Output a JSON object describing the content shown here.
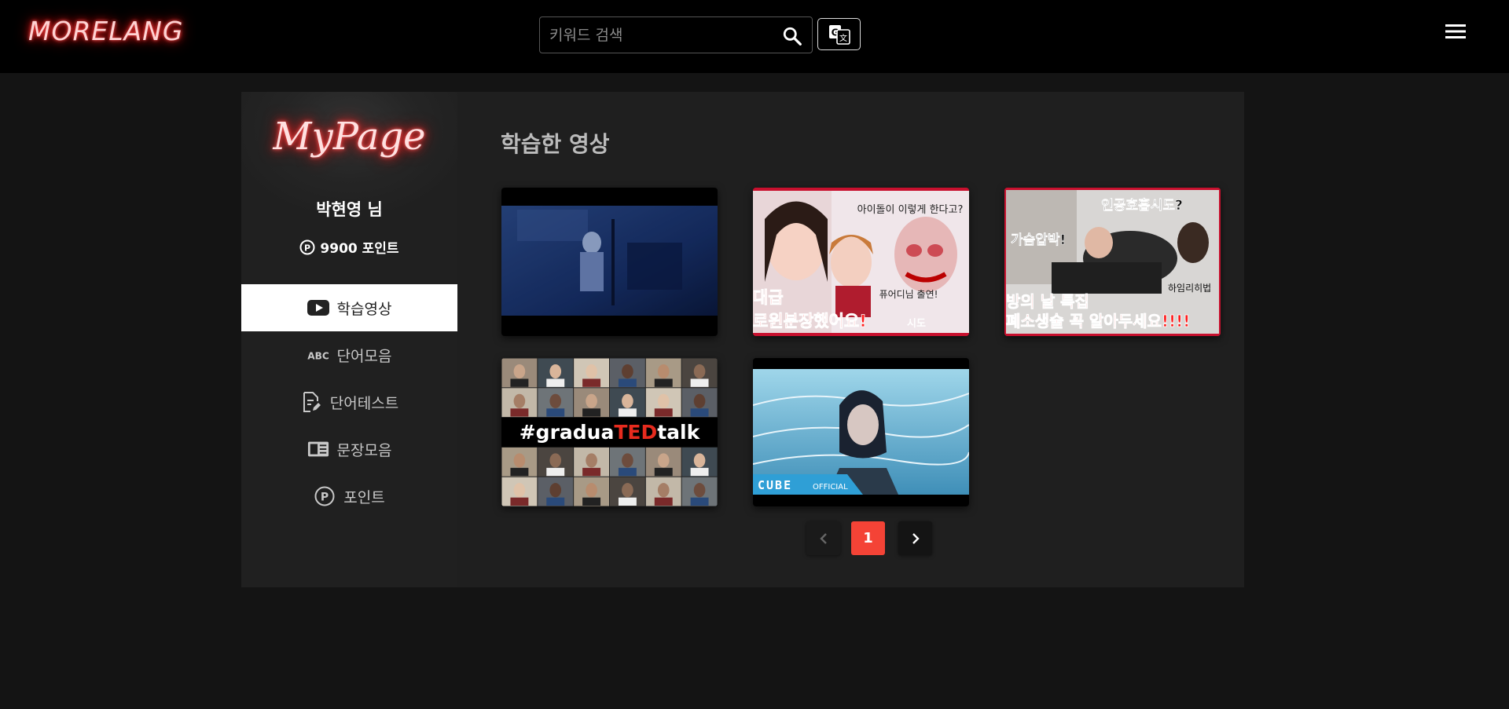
{
  "header": {
    "logo": "MORELANG",
    "search": {
      "placeholder": "키워드 검색",
      "value": ""
    },
    "icons": {
      "search": "search-icon",
      "translate": "translate-icon",
      "menu": "hamburger-menu-icon"
    }
  },
  "sidebar": {
    "logo": "MyPage",
    "user_name": "박현영 님",
    "points_text": "9900 포인트",
    "items": [
      {
        "label": "학습영상",
        "icon": "youtube-icon",
        "active": true
      },
      {
        "label": "단어모음",
        "icon": "abc-icon",
        "active": false
      },
      {
        "label": "단어테스트",
        "icon": "document-edit-icon",
        "active": false
      },
      {
        "label": "문장모음",
        "icon": "article-icon",
        "active": false
      },
      {
        "label": "포인트",
        "icon": "points-icon",
        "active": false
      }
    ]
  },
  "main": {
    "title": "학습한 영상",
    "videos": [
      {
        "thumbnail": "dark-blue-room-scene"
      },
      {
        "thumbnail": "idol-halloween-makeup",
        "overlay_top": "아이돌이 이렇게 한다고?",
        "overlay_mid": "퓨어디님 출연!",
        "overlay_bottom": "대급\n로윈분장했어요!",
        "overlay_tag": "시도"
      },
      {
        "thumbnail": "cpr-training",
        "overlay_top": "인공호흡시도?",
        "overlay_left": "가슴압박!",
        "overlay_right": "하임리히법",
        "overlay_bottom1": "방의 날 특집",
        "overlay_bottom2": "폐소생술 꼭 알아두세요!!!!"
      },
      {
        "thumbnail": "ted-video-grid",
        "overlay_text_pre": "#gradua",
        "overlay_text_ted": "TED",
        "overlay_text_post": "talk"
      },
      {
        "thumbnail": "barbed-wire-music-video",
        "overlay_brand": "CUBE",
        "overlay_brand_sub": "OFFICIAL"
      }
    ]
  },
  "pagination": {
    "current_page": "1"
  },
  "colors": {
    "accent": "#f44336",
    "logo_glow": "#ff2020",
    "active_bg": "#ffffff"
  }
}
